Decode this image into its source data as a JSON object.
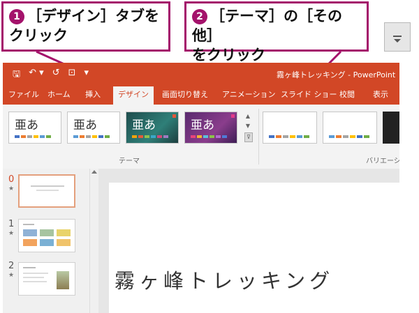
{
  "callouts": {
    "step1": {
      "number": "❶",
      "line1": "［デザイン］タブを",
      "line2": "クリック"
    },
    "step2": {
      "number": "❷",
      "line1": "［テーマ］の［その他］",
      "line2": "をクリック"
    }
  },
  "window": {
    "title": "霧ヶ峰トレッキング - PowerPoint",
    "qat": {
      "save": "🖫",
      "undo": "↶ ▾",
      "redo": "↺",
      "present": "⊡",
      "more": "▾"
    }
  },
  "tabs": [
    "ファイル",
    "ホーム",
    "挿入",
    "デザイン",
    "画面切り替え",
    "アニメーション",
    "スライド ショー",
    "校閲",
    "表示"
  ],
  "ribbon": {
    "theme_glyph": "亜あ",
    "group_themes": "テーマ",
    "group_variants": "バリエーション",
    "scroll_up": "▲",
    "scroll_down": "▼",
    "more": "⊽"
  },
  "slides": {
    "numbers": [
      "0",
      "1",
      "2"
    ],
    "star": "★"
  },
  "slide_title": "霧ヶ峰トレッキング",
  "colors": {
    "accent": "#d24726",
    "callout": "#a4126b"
  }
}
